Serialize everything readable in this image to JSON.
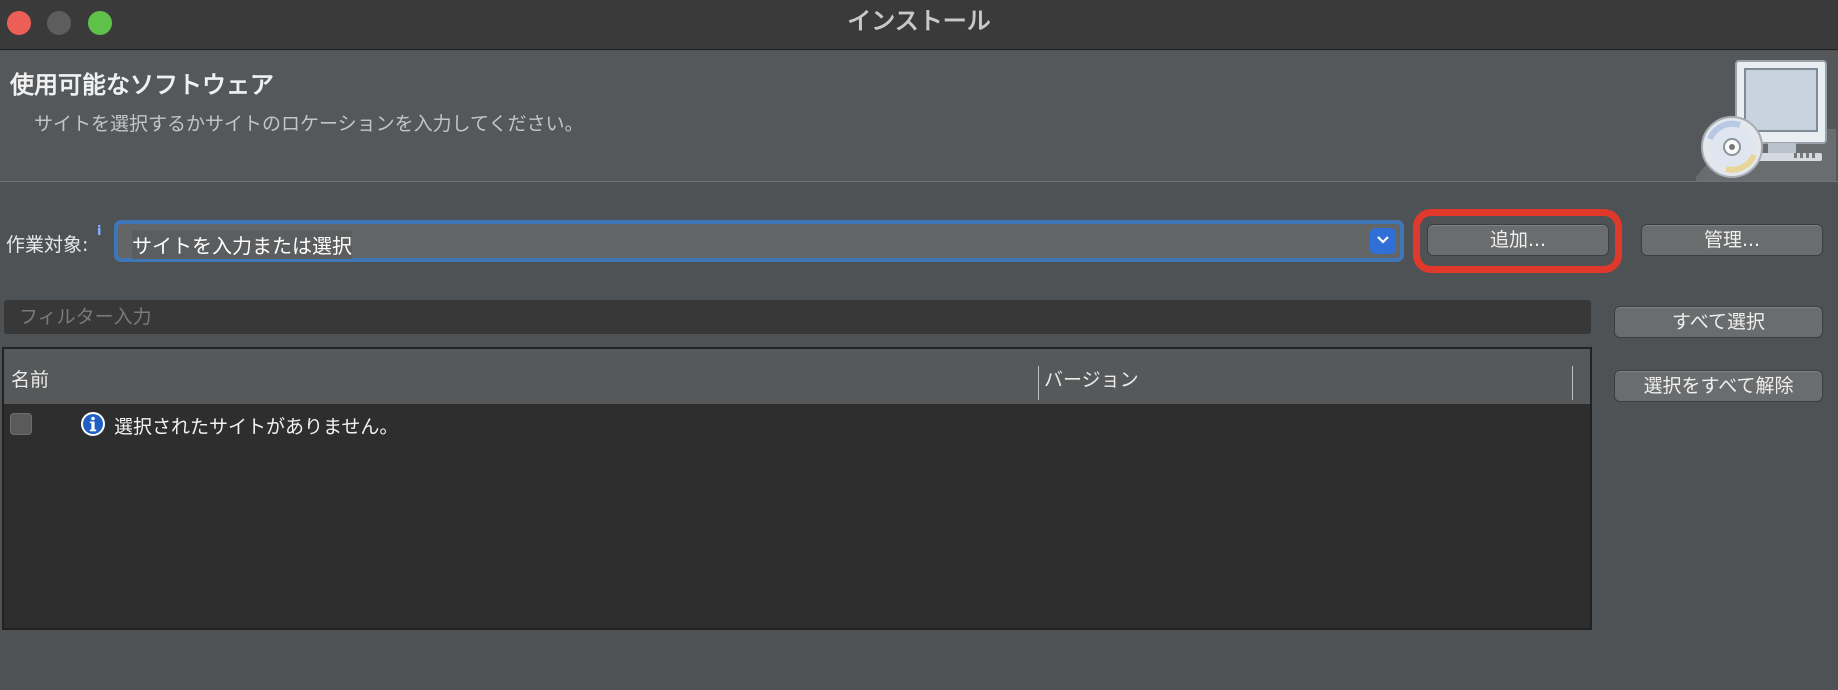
{
  "window": {
    "title": "インストール"
  },
  "banner": {
    "title": "使用可能なソフトウェア",
    "description": "サイトを選択するかサイトのロケーションを入力してください。"
  },
  "work_with": {
    "label": "作業対象:",
    "info_glyph": "i",
    "value": "サイトを入力または選択"
  },
  "buttons": {
    "add": "追加...",
    "manage": "管理...",
    "select_all": "すべて選択",
    "deselect_all": "選択をすべて解除"
  },
  "filter": {
    "placeholder": "フィルター入力"
  },
  "table": {
    "columns": [
      "名前",
      "バージョン"
    ],
    "empty_message": "選択されたサイトがありません。"
  },
  "colors": {
    "highlight": "#e0392b",
    "combo_focus": "#3f76b8",
    "combo_button": "#2f6fd6"
  }
}
